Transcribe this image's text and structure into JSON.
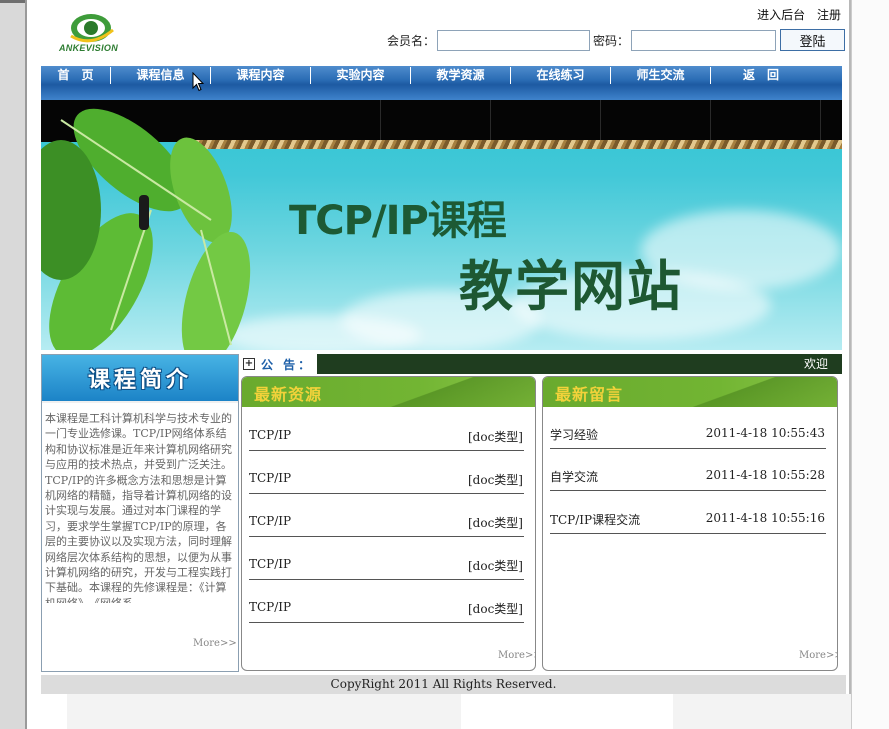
{
  "header": {
    "logo_text": "ANKEVISION",
    "top_links": [
      "进入后台",
      "注册"
    ],
    "login": {
      "username_label": "会员名：",
      "password_label": "密码：",
      "submit_label": "登陆"
    }
  },
  "nav": {
    "items": [
      "首　页",
      "课程信息",
      "课程内容",
      "实验内容",
      "教学资源",
      "在线练习",
      "师生交流",
      "返　回"
    ]
  },
  "banner": {
    "title_line1": "TCP/IP课程",
    "title_line2": "教学网站"
  },
  "announcement": {
    "label": "公 告：",
    "text": "欢迎",
    "icon": "plus-square-icon"
  },
  "intro": {
    "heading": "课程简介",
    "body": "本课程是工科计算机科学与技术专业的一门专业选修课。TCP/IP网络体系结构和协议标准是近年来计算机网络研究与应用的技术热点，并受到广泛关注。TCP/IP的许多概念方法和思想是计算机网络的精髓，指导着计算机网络的设计实现与发展。通过对本门课程的学习，要求学生掌握TCP/IP的原理，各层的主要协议以及实现方法，同时理解网络层次体系结构的思想，以便为从事计算机网络的研究，开发与工程实践打下基础。本课程的先修课程是：《计算机网络》、《网络系",
    "more": "More>>"
  },
  "resources": {
    "heading": "最新资源",
    "items": [
      {
        "name": "TCP/IP",
        "type": "[doc类型]"
      },
      {
        "name": "TCP/IP",
        "type": "[doc类型]"
      },
      {
        "name": "TCP/IP",
        "type": "[doc类型]"
      },
      {
        "name": "TCP/IP",
        "type": "[doc类型]"
      },
      {
        "name": "TCP/IP",
        "type": "[doc类型]"
      }
    ],
    "more": "More>>"
  },
  "messages": {
    "heading": "最新留言",
    "items": [
      {
        "title": "学习经验",
        "time": "2011-4-18 10:55:43"
      },
      {
        "title": "自学交流",
        "time": "2011-4-18 10:55:28"
      },
      {
        "title": "TCP/IP课程交流",
        "time": "2011-4-18 10:55:16"
      }
    ],
    "more": "More>>"
  },
  "footer": {
    "copyright": "CopyRight 2011 All Rights Reserved."
  }
}
